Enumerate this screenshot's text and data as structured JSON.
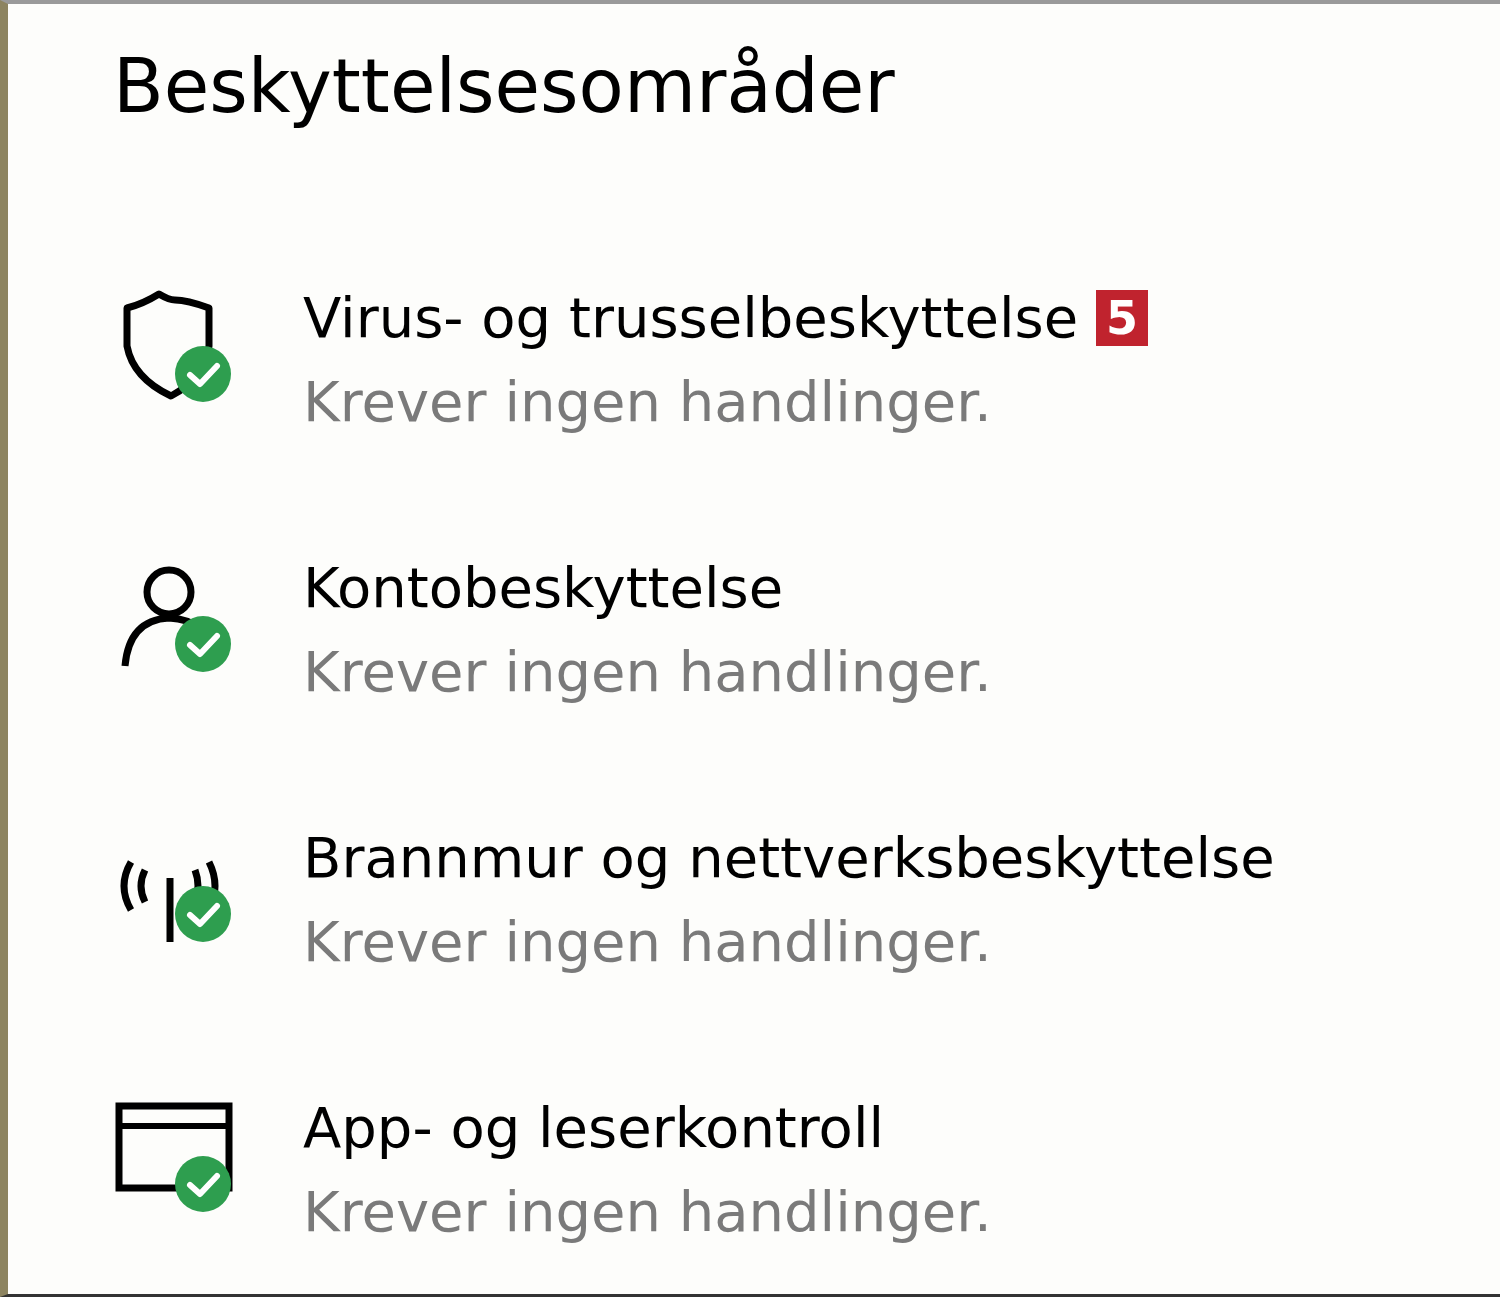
{
  "heading": "Beskyttelsesområder",
  "areas": [
    {
      "kind": "shield",
      "ok": true,
      "title": "Virus- og trusselbeskyttelse",
      "badge": "5",
      "subtitle": "Krever ingen handlinger."
    },
    {
      "kind": "person",
      "ok": true,
      "title": "Kontobeskyttelse",
      "subtitle": "Krever ingen handlinger."
    },
    {
      "kind": "signal",
      "ok": true,
      "title": "Brannmur og nettverksbeskyttelse",
      "subtitle": "Krever ingen handlinger."
    },
    {
      "kind": "window",
      "ok": true,
      "title": "App- og leserkontroll",
      "subtitle": "Krever ingen handlinger."
    }
  ]
}
